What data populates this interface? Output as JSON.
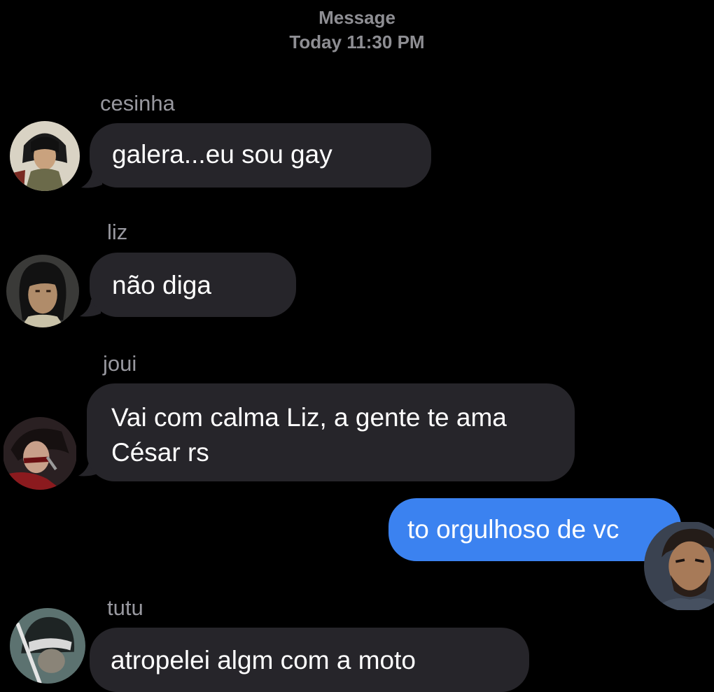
{
  "header": {
    "title": "Message",
    "timestamp": "Today 11:30 PM"
  },
  "messages": [
    {
      "sender": "cesinha",
      "text": "galera...eu sou gay",
      "direction": "incoming",
      "avatar": "avatar-cesinha"
    },
    {
      "sender": "liz",
      "text": "não diga",
      "direction": "incoming",
      "avatar": "avatar-liz"
    },
    {
      "sender": "joui",
      "text_line1": "Vai com calma Liz, a gente te ama",
      "text_line2": "César rs",
      "direction": "incoming",
      "avatar": "avatar-joui"
    },
    {
      "sender": "",
      "text": "to orgulhoso de vc",
      "direction": "outgoing",
      "avatar": "avatar-self"
    },
    {
      "sender": "tutu",
      "text": "atropelei algm com a moto",
      "direction": "incoming",
      "avatar": "avatar-tutu"
    }
  ],
  "colors": {
    "background": "#000000",
    "incoming_bubble": "#26252a",
    "outgoing_bubble": "#3b82f0",
    "sender_name": "#98989f",
    "header_text": "#8e8e93"
  }
}
